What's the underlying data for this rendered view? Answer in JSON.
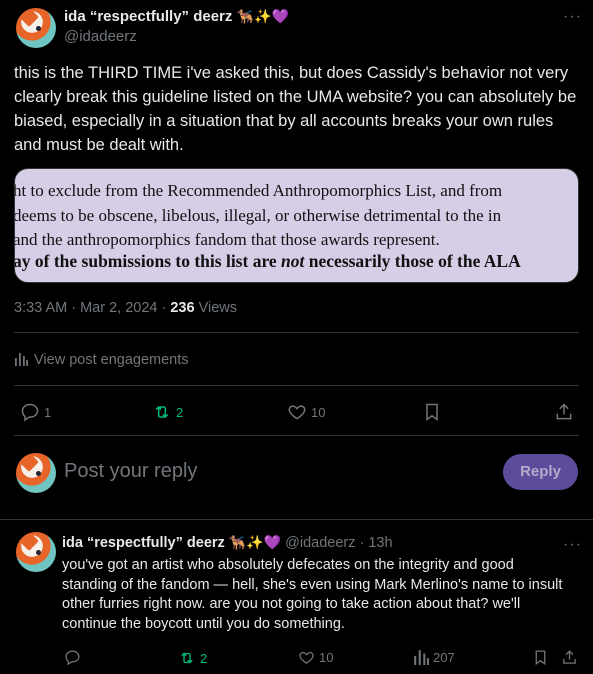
{
  "post": {
    "author_name": "ida “respectfully” deerz",
    "author_emoji": "🐕‍🦺✨💜",
    "handle": "@idadeerz",
    "text": "this is the THIRD TIME i've asked this, but does Cassidy's behavior not very clearly break this guideline listed on the UMA website? you can absolutely be biased, especially in a situation that by all accounts breaks your own rules and must be dealt with.",
    "image_lines": [
      "ht to exclude from the Recommended Anthropomorphics List, and from",
      "deems to be obscene, libelous, illegal, or otherwise detrimental to the in",
      "and the anthropomorphics fandom that those awards represent."
    ],
    "image_bold_line_before": "ay of the submissions to this list are ",
    "image_bold_line_italic": "not",
    "image_bold_line_after": " necessarily those of the ALA",
    "time": "3:33 AM · Mar 2, 2024 · ",
    "views_count": "236",
    "views_label": " Views",
    "engagements_label": "View post engagements",
    "replies": "1",
    "reposts": "2",
    "likes": "10"
  },
  "composer": {
    "placeholder": "Post your reply",
    "reply_button": "Reply"
  },
  "reply": {
    "author_name": "ida “respectfully” deerz",
    "author_emoji": "🐕‍🦺✨💜",
    "handle_time": "@idadeerz · 13h",
    "text": "you've got an artist who absolutely defecates on the integrity and good standing of the fandom — hell, she's even using Mark Merlino's name to insult other furries right now. are you not going to take action about that? we'll continue the boycott until you do something.",
    "reposts": "2",
    "likes": "10",
    "views": "207"
  },
  "colors": {
    "background": "#000000",
    "text": "#e7e9ea",
    "muted": "#71767b",
    "repost_green": "#00ba7c",
    "reply_button": "#5d4b9c"
  }
}
